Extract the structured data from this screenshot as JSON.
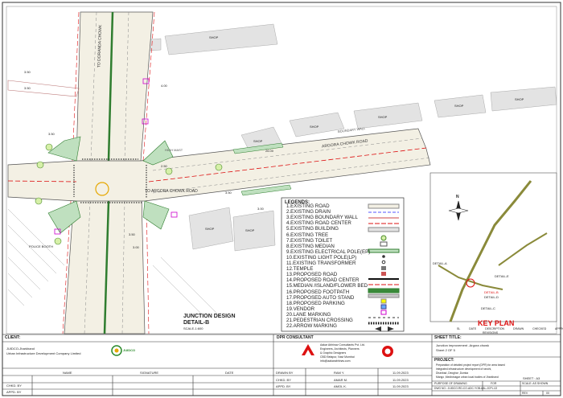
{
  "colors": {
    "road_fill": "#f4f1e8",
    "island_green": "#bfe0bf",
    "median_green": "#3a8a3a",
    "footpath_grey": "#c9c9c9",
    "red_dash": "#d11",
    "building_grey": "#d9d9d9",
    "key_road": "#8a8a3a"
  },
  "drawing": {
    "road_labels": [
      "TO ARGORA CHOWK ROAD",
      "TO DORANDA CHOWK",
      "ARGORA CHOWK ROAD",
      "BOUNDARY WALL",
      "HIGH MAST"
    ],
    "shop_labels": [
      "SHOP",
      "SHOP",
      "SHOP",
      "SHOP",
      "SHOP",
      "SHOP",
      "SHOP",
      "SHOP"
    ],
    "dims": [
      "3.50",
      "3.50",
      "3.50",
      "3.00",
      "2.50",
      "26.00",
      "3.50",
      "3.00",
      "3.50",
      "4.00"
    ],
    "police_booth": "POLICE BOOTH"
  },
  "detail": {
    "title": "JUNCTION DESIGN",
    "subtitle": "DETAIL-B",
    "scale": "SCALE-1:600"
  },
  "legend": {
    "title": "LEGENDS:",
    "items": [
      "1.EXISTING ROAD",
      "2.EXISTING DRAIN",
      "3.EXISTING BOUNDARY WALL",
      "4.EXISTING ROAD CENTER",
      "5.EXISTING BUILDING",
      "6.EXISTING TREE",
      "7.EXISTING TOILET",
      "8.EXISTING MEDIAN",
      "9.EXISTING ELECTRICAL POLE(EP)",
      "10.EXISTING LIGHT POLE(LP)",
      "11.EXISTING TRANSFORMER",
      "12.TEMPLE",
      "13.PROPOSED ROAD",
      "14.PROPOSED ROAD CENTER",
      "15.MEDIAN /ISLAND/FLOWER BED",
      "16.PROPOSED FOOTPATH",
      "17.PROPOSED AUTO STAND",
      "18.PROPOSED PARKING",
      "19.VENDOR",
      "20.LANE MARKING",
      "21.PEDESTRIAN CROSSING",
      "22.ARROW MARKING"
    ]
  },
  "key_plan": {
    "title": "KEY PLAN",
    "compass_label": "N",
    "details": [
      "DETAIL-A",
      "DETAIL-E",
      "DETAIL-B",
      "DETAIL-D",
      "DETAIL-C"
    ],
    "revision_headers": [
      "SL",
      "DATE",
      "DESCRIPTION",
      "DRAWN",
      "CHECKED",
      "APPROVED"
    ],
    "revisions_label": "REVISIONS"
  },
  "title_block": {
    "client_header": "CLIENT:",
    "client_name": "JUIDCO-Jharkhand",
    "client_full": "Urban Infrastructure Development Company Limited",
    "juidco_logo": "JUIDCO",
    "name_header": "NAME",
    "signature_header": "SIGNATURE",
    "date_header": "DATE",
    "chkd_by": "CHKD. BY",
    "appd_by": "APPD. BY",
    "dpr_header": "DPR CONSULTANT",
    "consultant_lines": [
      "Aakar Abhinav Consultants Pvt. Ltd.",
      "Engineers, Architects, Planners",
      "& Graphic Designers",
      "CBD Belapur, Navi Mumbai",
      "info@aakarabhinav.com"
    ],
    "drawn_by": "DRAWN BY",
    "chkd_by2": "CHKD. BY",
    "appd_by2": "APPD. BY",
    "drawn_name": "RAM Y.",
    "chkd_name": "AMAR M.",
    "appd_name": "AMOL K.",
    "drawn_date": "11.09.2023",
    "chkd_date": "11.09.2023",
    "appd_date": "11.09.2023",
    "sheet_title_header": "SHEET TITLE:",
    "sheet_title_1": "Junction improvement -Argora chowk",
    "sheet_title_2": "Sheet 2 OF 5",
    "project_header": "PROJECT:",
    "project_lines": [
      "Preparation of detailed project report (DPR) for area based",
      "integrated infrastructure development of ranchi,",
      "Dhanbad ,Deoghar ,Dumka",
      "Mango ,Medininagar urban local bodies of Jharkhand"
    ],
    "sheet_label": "SHEET : A3",
    "purpose_label": "PURPOSE OF DRAWING",
    "purpose_value": "FOR",
    "scale_label": "SCALE: AS SHOWN",
    "dwg_no": "DWG NO.: JUIDCO-RD-CO-ADC-YOB-AAL-JCPL-02",
    "rev_label": "REV",
    "rev_value": "00"
  }
}
